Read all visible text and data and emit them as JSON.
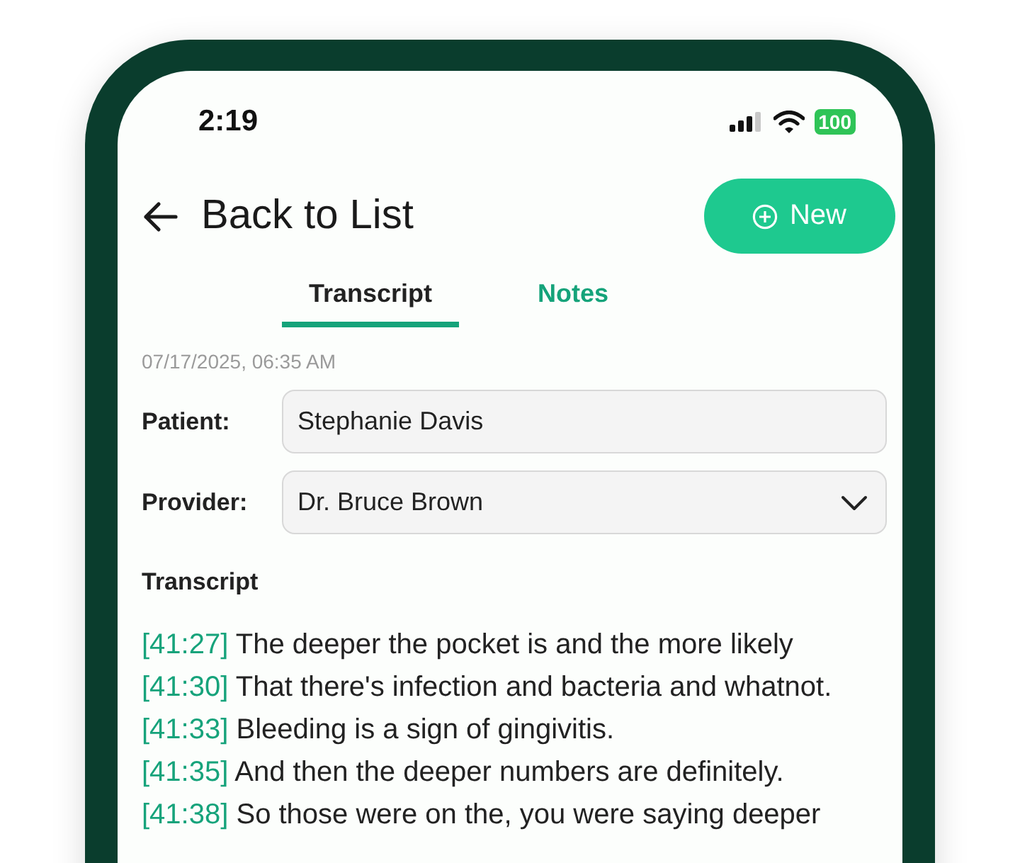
{
  "status_bar": {
    "time": "2:19",
    "battery": "100"
  },
  "header": {
    "back_label": "Back to List",
    "new_button": "New"
  },
  "tabs": [
    {
      "label": "Transcript",
      "selected": true
    },
    {
      "label": "Notes",
      "selected": false
    }
  ],
  "timestamp": "07/17/2025, 06:35 AM",
  "fields": [
    {
      "label": "Patient:",
      "value": "Stephanie Davis",
      "kind": "text"
    },
    {
      "label": "Provider:",
      "value": "Dr. Bruce Brown",
      "kind": "select"
    }
  ],
  "transcript": {
    "heading": "Transcript",
    "lines": [
      {
        "time": "[41:27]",
        "text": "The deeper the pocket is and the more likely"
      },
      {
        "time": "[41:30]",
        "text": "That there's infection and bacteria and whatnot."
      },
      {
        "time": "[41:33]",
        "text": "Bleeding is a sign of gingivitis."
      },
      {
        "time": "[41:35]",
        "text": "And then the deeper numbers are definitely."
      },
      {
        "time": "[41:38]",
        "text": "So those were on the, you were saying deeper"
      }
    ]
  }
}
